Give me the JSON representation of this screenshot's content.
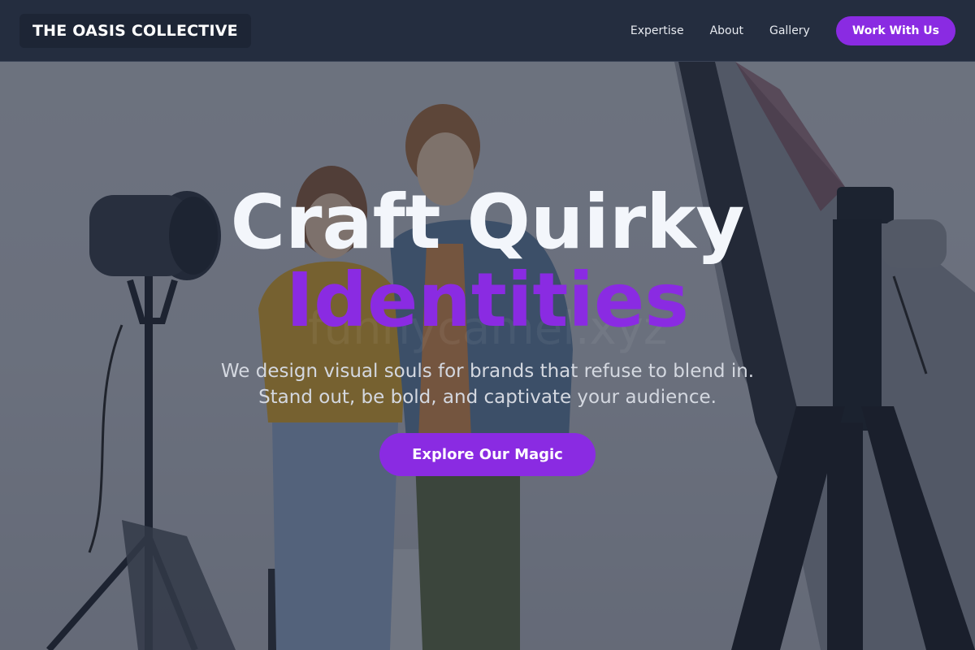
{
  "navbar": {
    "brand": "THE OASIS COLLECTIVE",
    "links": [
      {
        "label": "Expertise"
      },
      {
        "label": "About"
      },
      {
        "label": "Gallery"
      }
    ],
    "cta_label": "Work With Us"
  },
  "hero": {
    "title_line1": "Craft Quirky",
    "title_line2": "Identities",
    "subtitle": "We design visual souls for brands that refuse to blend in. Stand out, be bold, and captivate your audience.",
    "cta_label": "Explore Our Magic",
    "watermark": "funnycamel.xyz"
  },
  "colors": {
    "accent": "#8a2be2",
    "navbar_bg": "#242d3f",
    "title_text": "#f3f6fb"
  }
}
